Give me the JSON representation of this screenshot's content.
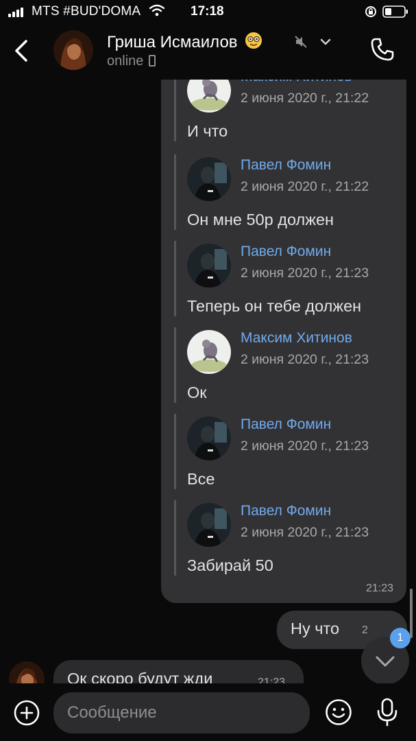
{
  "status_bar": {
    "carrier": "MTS #BUD'DOMA",
    "time": "17:18"
  },
  "header": {
    "contact_name": "Гриша Исмаилов",
    "status": "online",
    "icons": [
      "back-icon",
      "nerd-face-emoji",
      "mute-icon",
      "chevron-down-icon",
      "phone-icon"
    ]
  },
  "forwarded_bubble": {
    "time": "21:23",
    "items": [
      {
        "author": "Максим Хитинов",
        "date": "2 июня 2020 г., 21:22",
        "text": "И что"
      },
      {
        "author": "Павел Фомин",
        "date": "2 июня 2020 г., 21:22",
        "text": "Он мне 50р должен"
      },
      {
        "author": "Павел Фомин",
        "date": "2 июня 2020 г., 21:23",
        "text": "Теперь он тебе должен"
      },
      {
        "author": "Максим Хитинов",
        "date": "2 июня 2020 г., 21:23",
        "text": "Ок"
      },
      {
        "author": "Павел Фомин",
        "date": "2 июня 2020 г., 21:23",
        "text": "Все"
      },
      {
        "author": "Павел Фомин",
        "date": "2 июня 2020 г., 21:23",
        "text": "Забирай 50"
      }
    ]
  },
  "outgoing_message": {
    "text": "Ну что",
    "time": "2"
  },
  "incoming_message": {
    "text": "Ок скоро будут жди",
    "time": "21:23"
  },
  "scroll_down": {
    "badge_count": "1"
  },
  "composer": {
    "placeholder": "Сообщение"
  },
  "colors": {
    "accent": "#71aaeb",
    "badge": "#5aa0eb",
    "bubble": "#323234",
    "background": "#0a0a0a"
  }
}
